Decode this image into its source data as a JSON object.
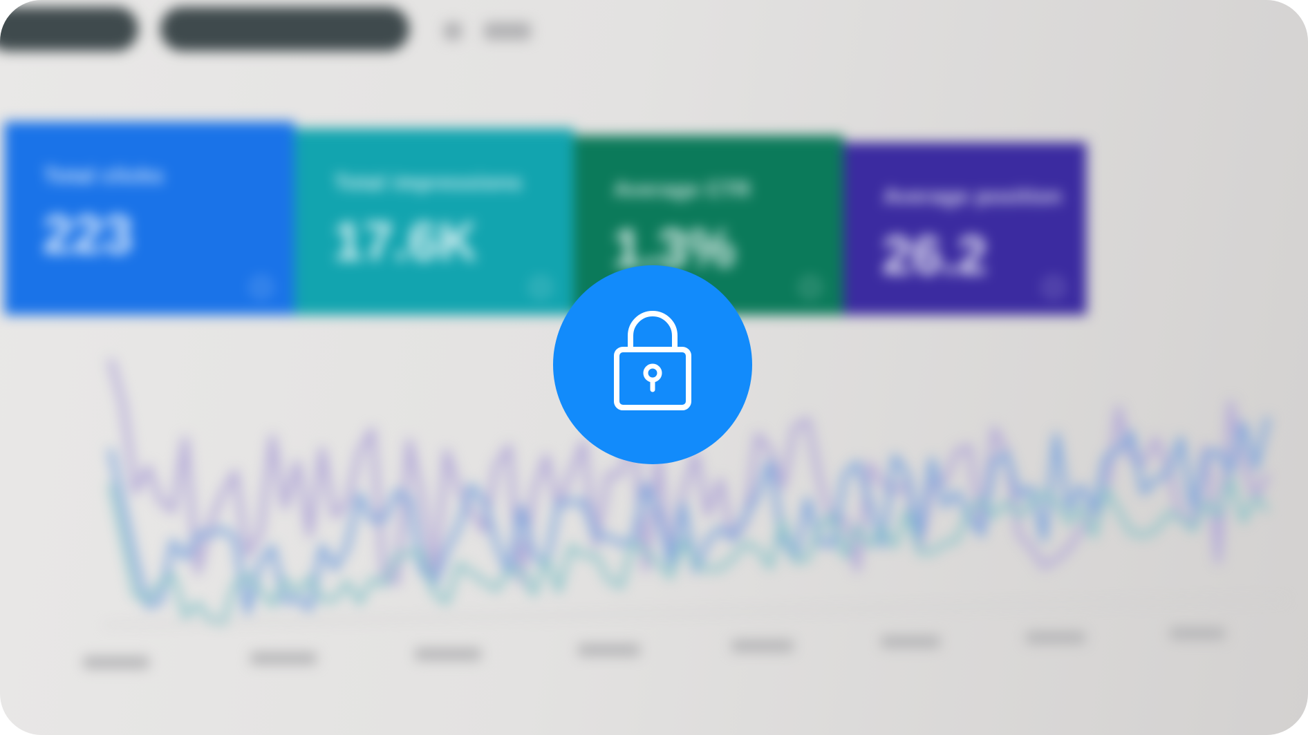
{
  "screen": {
    "state": "locked-preview",
    "overlay_color": "#128bfb",
    "overlay_icon": "padlock"
  },
  "metrics": [
    {
      "id": "total-clicks",
      "label": "Total clicks",
      "value": "223",
      "color": "#1a73e8"
    },
    {
      "id": "total-impressions",
      "label": "Total impressions",
      "value": "17.6K",
      "color": "#12a4af"
    },
    {
      "id": "average-ctr",
      "label": "Average CTR",
      "value": "1.3%",
      "color": "#0b7a5a"
    },
    {
      "id": "average-position",
      "label": "Average position",
      "value": "26.2",
      "color": "#3b2ba0"
    }
  ],
  "chart": {
    "series_colors": [
      "#b5acd8",
      "#7fa6dc",
      "#86c2c8"
    ]
  }
}
